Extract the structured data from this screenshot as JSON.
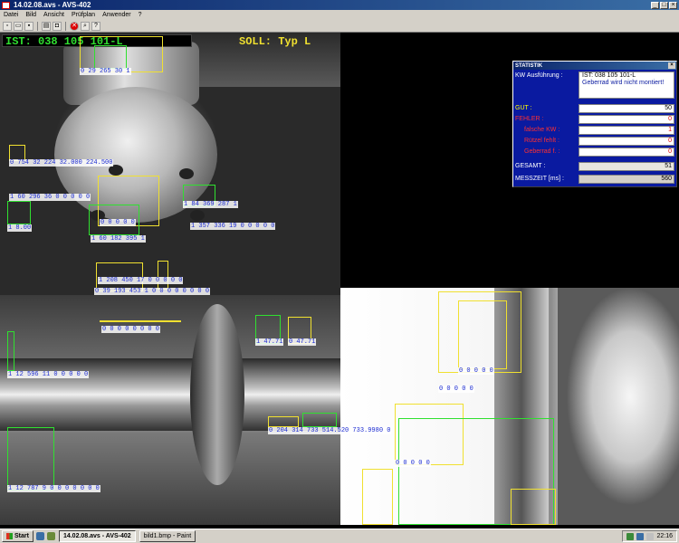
{
  "window": {
    "title": "14.02.08.avs - AVS-402"
  },
  "menu": [
    "Datei",
    "Bild",
    "Ansicht",
    "Prüfplan",
    "Anwender",
    "?"
  ],
  "toolbar": {
    "icons": [
      "new-icon",
      "open-icon",
      "save-icon",
      "print-icon",
      "camera-icon",
      "stop-icon",
      "zoom-icon",
      "help-icon"
    ]
  },
  "header": {
    "ist": "IST: 038 105 101-L",
    "soll": "SOLL: Typ L"
  },
  "overlays": {
    "t1": "0 29 265 30 1",
    "t2": "0 754 32 224 32.000 224.500",
    "t3": "1 60 296 36 0 0 0 0 0",
    "t4": "1 84 369 287 1",
    "t5": "1 8.00",
    "t6": "0 0 0 0 0",
    "t7": "1 60 182 395 1",
    "t8": "1 357 336 19 0 0 0 0 0",
    "t9": "1 208 450 17 0 0 0 0 0",
    "t10": "0 39 193 453 1 0 0 0 0 0 0 0 0",
    "t11": "0 0 0 0 0 0 0 0",
    "t12": "1 47.71",
    "t13": "0 47.71",
    "t14": "1 12 596 11 0 0 0 0 0",
    "t15": "0 0 0 0 0",
    "t16": "0 0 0 0 0",
    "t17": "0 0 0 0 0",
    "t18": "0 204 314 733 514.520 733.9980 0",
    "t19": "1 12 787 9 0 0 0 0 0 0 0"
  },
  "statistik": {
    "title": "STATISTIK",
    "kw_label": "KW Ausführung :",
    "kw_value": "IST: 038 105 101-L",
    "message": "Geberrad wird nicht montiert!",
    "gut_label": "GUT :",
    "gut_value": "50",
    "fehler_label": "FEHLER :",
    "fehler_value": "0",
    "falsche_label": "falsche KW :",
    "falsche_value": "1",
    "ruetzel_label": "Rützel fehlt :",
    "ruetzel_value": "0",
    "geberrad_label": "Geberrad f. :",
    "geberrad_value": "0",
    "gesamt_label": "GESAMT :",
    "gesamt_value": "51",
    "messzeit_label": "MESSZEIT [ms] :",
    "messzeit_value": "560"
  },
  "taskbar": {
    "start": "Start",
    "tasks": [
      "14.02.08.avs - AVS-402",
      "bild1.bmp - Paint"
    ],
    "clock": "22:16"
  },
  "colors": {
    "accent_green": "#30e030",
    "accent_yellow": "#f0e030",
    "measure_blue": "#1a2ad0",
    "stat_bg": "#0a1aa0"
  }
}
